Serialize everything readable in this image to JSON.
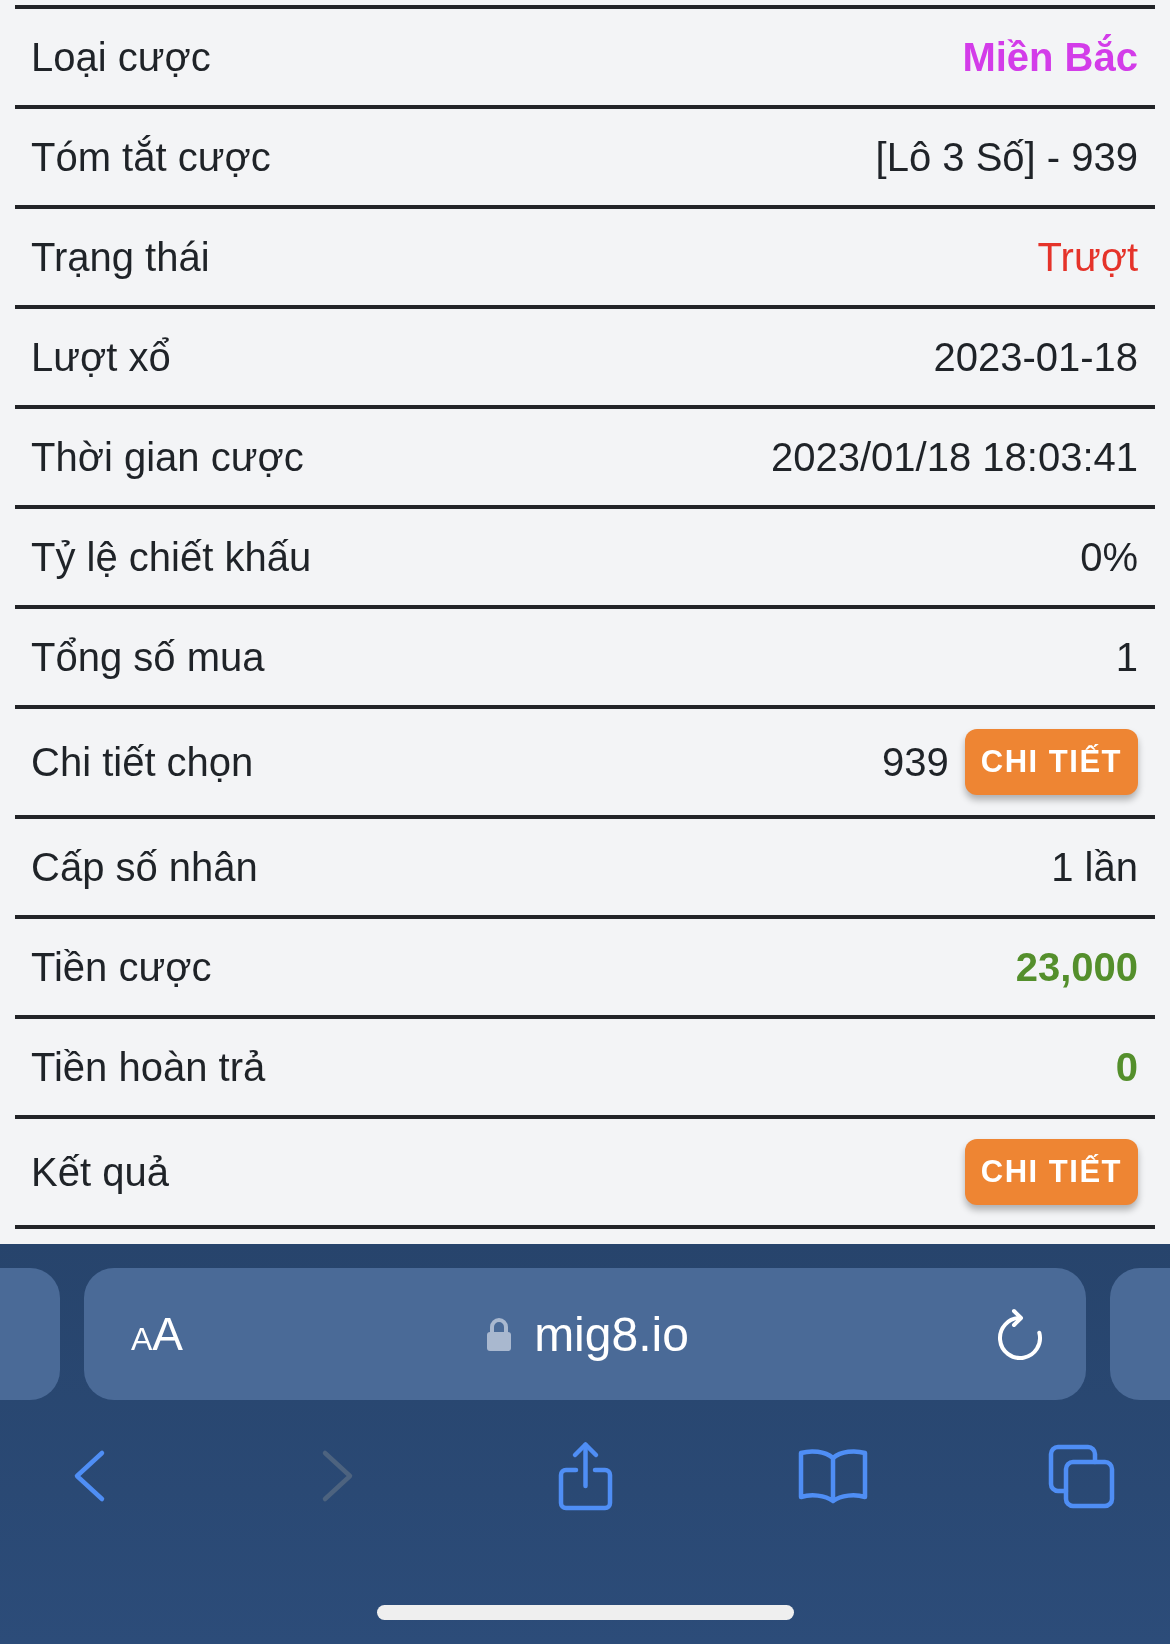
{
  "rows": [
    {
      "label": "Loại cược",
      "value": "Miền Bắc",
      "color": "#d33ce9",
      "bold": true
    },
    {
      "label": "Tóm tắt cược",
      "value": "[Lô 3 Số] - 939",
      "bold": false
    },
    {
      "label": "Trạng thái",
      "value": "Trượt",
      "color": "#e5332a",
      "bold": false
    },
    {
      "label": "Lượt xổ",
      "value": "2023-01-18",
      "bold": false
    },
    {
      "label": "Thời gian cược",
      "value": "2023/01/18 18:03:41",
      "bold": false
    },
    {
      "label": "Tỷ lệ chiết khấu",
      "value": "0%",
      "bold": false
    },
    {
      "label": "Tổng số mua",
      "value": "1",
      "bold": false
    },
    {
      "label": "Chi tiết chọn",
      "value": "939",
      "bold": false,
      "button": "CHI TIẾT"
    },
    {
      "label": "Cấp số nhân",
      "value": "1 lần",
      "bold": false
    },
    {
      "label": "Tiền cược",
      "value": "23,000",
      "color": "#548f2c",
      "bold": true
    },
    {
      "label": "Tiền hoàn trả",
      "value": "0",
      "color": "#548f2c",
      "bold": true
    },
    {
      "label": "Kết quả",
      "button": "CHI TIẾT"
    }
  ],
  "browser": {
    "text_size_button": "AA",
    "url": "mig8.io",
    "back_button": {
      "disabled": false
    },
    "forward_button": {
      "disabled": true
    }
  }
}
